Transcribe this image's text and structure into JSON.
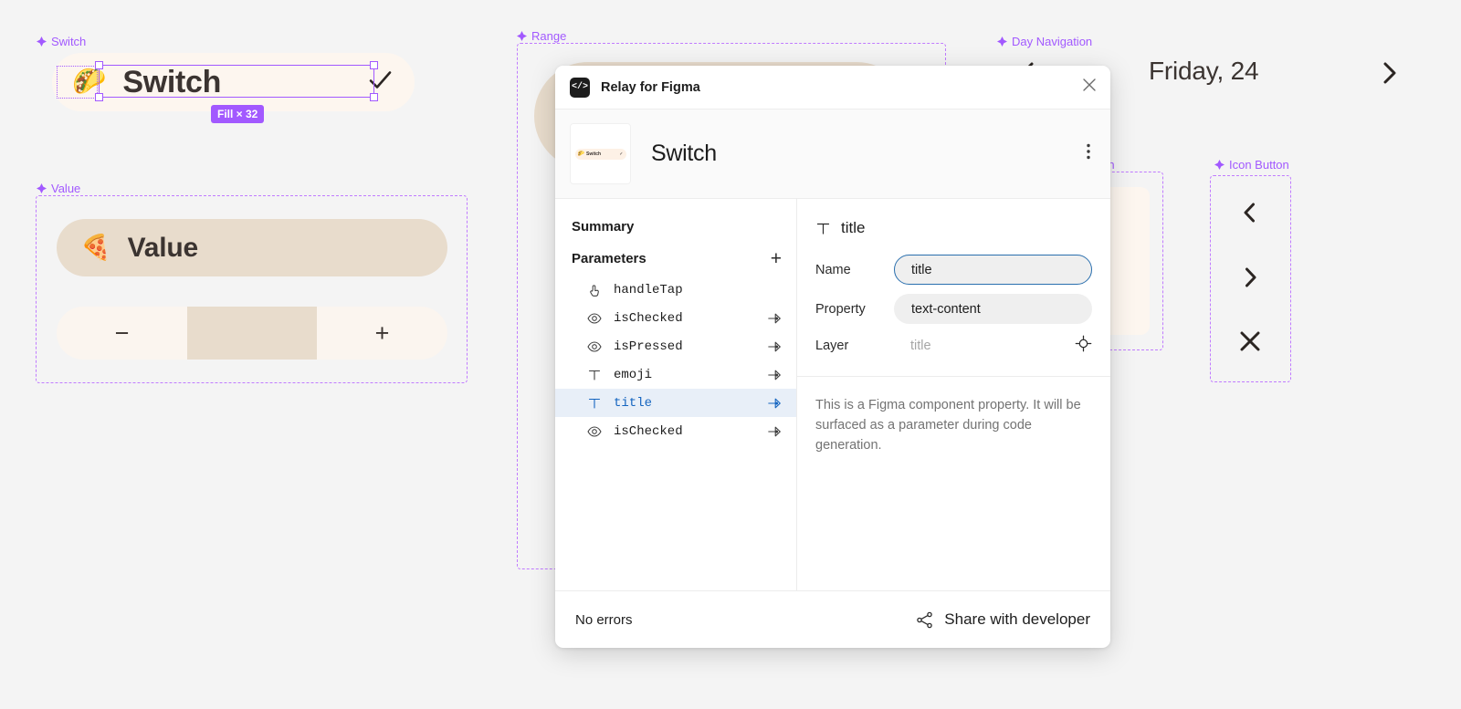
{
  "canvas": {
    "background": "#f4f4f4",
    "accent_purple": "#a259ff",
    "accent_blue": "#1565c0",
    "beige": "#e8dccc",
    "cream": "#fdf6ef"
  },
  "switch_component": {
    "frame_label": "Switch",
    "emoji": "🌮",
    "title": "Switch",
    "check_icon": "check-icon",
    "badge": "Fill × 32"
  },
  "value_component": {
    "frame_label": "Value",
    "emoji": "🍕",
    "title": "Value",
    "stepper": {
      "minus": "−",
      "plus": "+",
      "value": ""
    }
  },
  "range_component": {
    "frame_label": "Range"
  },
  "button_component": {
    "frame_label": "Button"
  },
  "day_navigation": {
    "frame_label": "Day Navigation",
    "date_label": "Friday, 24",
    "prev_icon": "chevron-left-icon",
    "next_icon": "chevron-right-icon"
  },
  "icon_button_component": {
    "frame_label": "Icon Button",
    "buttons": [
      {
        "name": "chevron-left-icon",
        "glyph": "‹"
      },
      {
        "name": "chevron-right-icon",
        "glyph": "›"
      },
      {
        "name": "close-icon",
        "glyph": "✕"
      }
    ]
  },
  "dialog": {
    "titlebar": {
      "title": "Relay for Figma",
      "logo": "</>",
      "close_icon": "close-icon"
    },
    "header": {
      "component_name": "Switch",
      "thumbnail": {
        "emoji": "🌮",
        "label": "Switch",
        "check": "✓"
      },
      "kebab_icon": "more-vertical-icon"
    },
    "sidebar": {
      "summary_label": "Summary",
      "parameters_label": "Parameters",
      "add_label": "+",
      "parameters": [
        {
          "name": "handleTap",
          "icon": "tap-icon",
          "has_link": false,
          "selected": false
        },
        {
          "name": "isChecked",
          "icon": "eye-icon",
          "has_link": true,
          "selected": false
        },
        {
          "name": "isPressed",
          "icon": "eye-icon",
          "has_link": true,
          "selected": false
        },
        {
          "name": "emoji",
          "icon": "text-icon",
          "has_link": true,
          "selected": false
        },
        {
          "name": "title",
          "icon": "text-icon",
          "has_link": true,
          "selected": true
        },
        {
          "name": "isChecked",
          "icon": "eye-icon",
          "has_link": true,
          "selected": false
        }
      ]
    },
    "detail": {
      "heading": "title",
      "heading_icon": "text-icon",
      "fields": [
        {
          "label": "Name",
          "value": "title",
          "style": "focused-pill"
        },
        {
          "label": "Property",
          "value": "text-content",
          "style": "pill"
        },
        {
          "label": "Layer",
          "value": "title",
          "style": "plain",
          "target_icon": "target-icon"
        }
      ],
      "description": "This is a Figma component property. It will be surfaced as a parameter during code generation."
    },
    "footer": {
      "status": "No errors",
      "share_label": "Share with developer",
      "share_icon": "share-icon"
    }
  }
}
